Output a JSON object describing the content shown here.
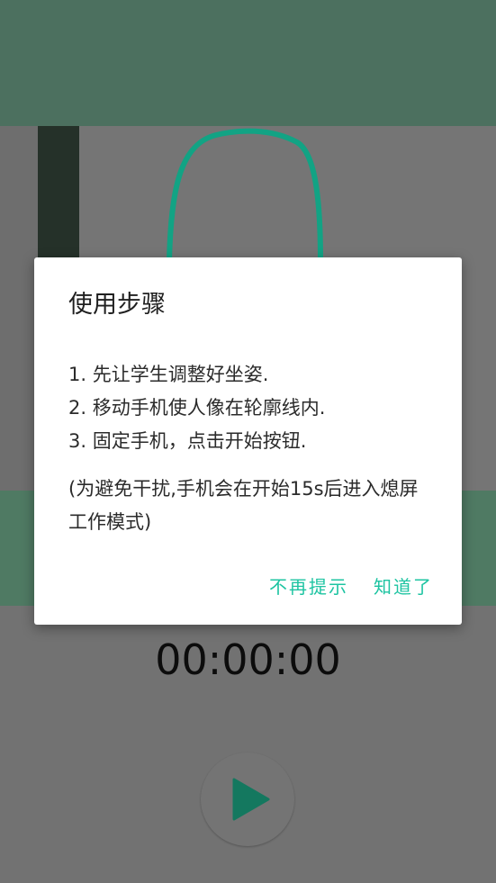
{
  "dialog": {
    "title": "使用步骤",
    "steps": [
      "1. 先让学生调整好坐姿.",
      "2. 移动手机使人像在轮廓线内.",
      "3. 固定手机，点击开始按钮."
    ],
    "note": "(为避免干扰,手机会在开始15s后进入熄屏工作模式)",
    "dont_remind_label": "不再提示",
    "got_it_label": "知道了"
  },
  "timer": {
    "value": "00:00:00"
  },
  "colors": {
    "accent": "#1ec4a2",
    "band_green": "#4f7a63",
    "top_green": "#4c705f",
    "outline": "#12a384",
    "play": "#14785f"
  },
  "icons": {
    "play": "play-icon"
  }
}
